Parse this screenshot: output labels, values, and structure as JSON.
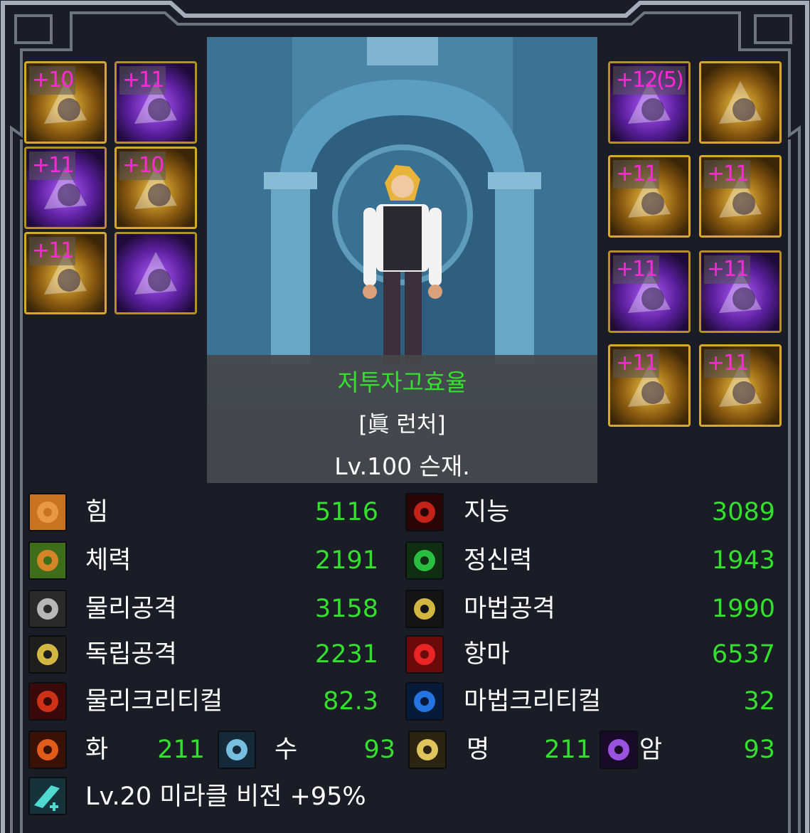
{
  "equipment": {
    "left": [
      {
        "name": "shoulder-item",
        "enhance": "+10",
        "theme": "gold"
      },
      {
        "name": "weapon-item",
        "enhance": "+11",
        "theme": "purple"
      },
      {
        "name": "top-item",
        "enhance": "+11",
        "theme": "purple"
      },
      {
        "name": "belt-item",
        "enhance": "+10",
        "theme": "gold"
      },
      {
        "name": "shoes-item",
        "enhance": "+11",
        "theme": "gold"
      },
      {
        "name": "avatar-item",
        "enhance": "",
        "theme": "purple"
      }
    ],
    "right": [
      {
        "name": "weapon-main-item",
        "enhance": "+12(5)",
        "theme": "purple"
      },
      {
        "name": "title-item",
        "enhance": "",
        "theme": "gold"
      },
      {
        "name": "bracelet-item",
        "enhance": "+11",
        "theme": "gold"
      },
      {
        "name": "necklace-item",
        "enhance": "+11",
        "theme": "gold"
      },
      {
        "name": "ring-item",
        "enhance": "+11",
        "theme": "purple"
      },
      {
        "name": "support-item",
        "enhance": "+11",
        "theme": "purple"
      },
      {
        "name": "magic-stone-item",
        "enhance": "+11",
        "theme": "gold"
      },
      {
        "name": "earring-item",
        "enhance": "+11",
        "theme": "gold"
      }
    ]
  },
  "character": {
    "guild": "저투자고효율",
    "title": "[眞 런처]",
    "level_name": "Lv.100 슨재."
  },
  "stats": {
    "left": [
      {
        "label": "힘",
        "value": "5116",
        "icon": "strength-icon"
      },
      {
        "label": "체력",
        "value": "2191",
        "icon": "vitality-icon"
      },
      {
        "label": "물리공격",
        "value": "3158",
        "icon": "physical-attack-icon"
      },
      {
        "label": "독립공격",
        "value": "2231",
        "icon": "independent-attack-icon"
      },
      {
        "label": "물리크리티컬",
        "value": "82.3",
        "icon": "physical-critical-icon"
      }
    ],
    "right": [
      {
        "label": "지능",
        "value": "3089",
        "icon": "intelligence-icon"
      },
      {
        "label": "정신력",
        "value": "1943",
        "icon": "spirit-icon"
      },
      {
        "label": "마법공격",
        "value": "1990",
        "icon": "magic-attack-icon"
      },
      {
        "label": "항마",
        "value": "6537",
        "icon": "adventure-fame-icon"
      },
      {
        "label": "마법크리티컬",
        "value": "32",
        "icon": "magic-critical-icon"
      }
    ],
    "elements": [
      {
        "label": "화",
        "value": "211",
        "icon": "fire-element-icon"
      },
      {
        "label": "수",
        "value": "93",
        "icon": "water-element-icon"
      },
      {
        "label": "명",
        "value": "211",
        "icon": "light-element-icon"
      },
      {
        "label": "암",
        "value": "93",
        "icon": "dark-element-icon"
      }
    ]
  },
  "skill": {
    "text": "Lv.20 미라클 비전 +95%",
    "icon": "skill-icon"
  }
}
